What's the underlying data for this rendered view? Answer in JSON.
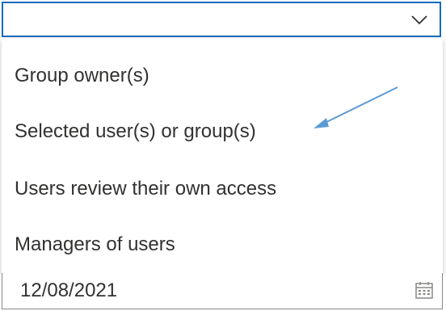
{
  "dropdown": {
    "selected_value": "",
    "options": [
      {
        "label": "Group owner(s)"
      },
      {
        "label": "Selected user(s) or group(s)"
      },
      {
        "label": "Users review their own access"
      },
      {
        "label": "Managers of users"
      }
    ],
    "highlighted_option_index": 1
  },
  "date_field": {
    "value": "12/08/2021"
  },
  "icons": {
    "dropdown": "chevron-down-icon",
    "annotation": "arrow-annotation-icon",
    "date": "calendar-icon"
  },
  "colors": {
    "focus_border": "#0f6cbd",
    "annotation_arrow": "#5b9bd5",
    "text": "#323130"
  }
}
